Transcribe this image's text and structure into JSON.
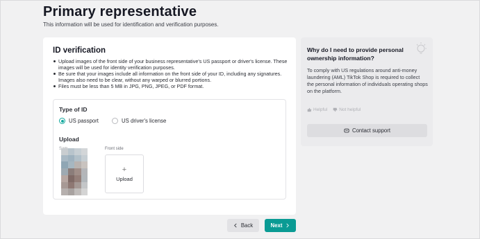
{
  "header": {
    "title": "Primary representative",
    "subtitle": "This information will be used for identification and verification purposes."
  },
  "id_verification": {
    "title": "ID verification",
    "bullets": [
      "Upload images of the front side of your business representative's US passport or driver's license. These images will be used for identity verification purposes.",
      "Be sure that your images include all information on the front side of your ID, including any signatures. Images also need to be clear, without any warped or blurred portions.",
      "Files must be less than 5 MB in JPG, PNG, JPEG, or PDF format."
    ],
    "type_of_id_label": "Type of ID",
    "options": [
      {
        "label": "US passport",
        "selected": true
      },
      {
        "label": "US driver's license",
        "selected": false
      }
    ],
    "upload_label": "Upload",
    "sample_label": "Sam",
    "front_side_label": "Front side",
    "upload_button_label": "Upload"
  },
  "side_panel": {
    "title": "Why do I need to provide personal ownership information?",
    "body": "To comply with US regulations around anti-money laundering (AML) TikTok Shop is required to collect the personal information of individuals operating shops on the platform.",
    "helpful_label": "Helpful",
    "not_helpful_label": "Not helpful",
    "contact_label": "Contact support"
  },
  "footer": {
    "back_label": "Back",
    "next_label": "Next"
  },
  "colors": {
    "accent": "#0a9b94",
    "background": "#f1f1f2"
  },
  "icons": {
    "bulb": "lightbulb-icon",
    "plus": "plus-icon",
    "thumbs_up": "thumbs-up-icon",
    "thumbs_down": "thumbs-down-icon",
    "chat": "chat-icon",
    "chevron_left": "chevron-left-icon",
    "chevron_right": "chevron-right-icon"
  }
}
